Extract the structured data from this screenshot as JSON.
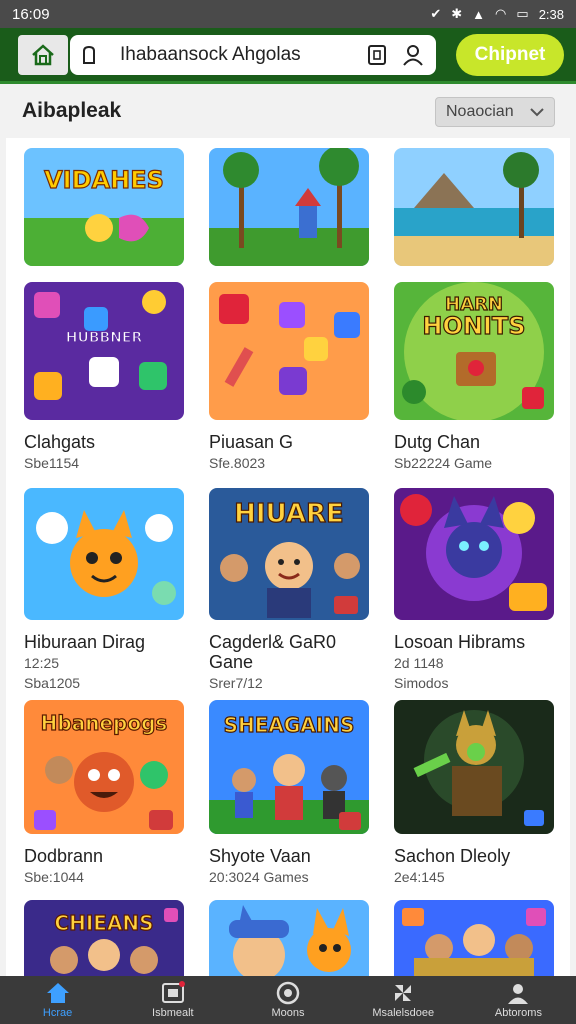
{
  "status": {
    "time": "16:09",
    "clock": "2:38"
  },
  "topbar": {
    "search_text": "Ihabaansock Ahgolas",
    "cta_label": "Chipnet"
  },
  "header": {
    "title": "Aibapleak",
    "sort_label": "Noaocian"
  },
  "games": [
    {
      "name": "",
      "meta": "",
      "meta2": "",
      "art": "title-art"
    },
    {
      "name": "",
      "meta": "",
      "meta2": "",
      "art": "palm-tower"
    },
    {
      "name": "",
      "meta": "",
      "meta2": "",
      "art": "beach"
    },
    {
      "name": "Clahgats",
      "meta": "Sbe1154",
      "meta2": "",
      "art": "dice-purple"
    },
    {
      "name": "Piuasan G",
      "meta": "Sfe.8023",
      "meta2": "",
      "art": "dice-orange"
    },
    {
      "name": "Dutg Chan",
      "meta": "Sb22224 Game",
      "meta2": "",
      "art": "harn-honits"
    },
    {
      "name": "Hiburaan Dirag",
      "meta": "12:25",
      "meta2": "Sba1205",
      "art": "cat"
    },
    {
      "name": "Cagderl& GaR0 Gane",
      "meta": "Srer7/12",
      "meta2": "",
      "art": "hiuare"
    },
    {
      "name": "Losoan Hibrams",
      "meta": "2d 1148",
      "meta2": "Simodos",
      "art": "wolf"
    },
    {
      "name": "Dodbrann",
      "meta": "Sbe:1044",
      "meta2": "",
      "art": "hbanepogs"
    },
    {
      "name": "Shyote Vaan",
      "meta": "20:3024 Games",
      "meta2": "",
      "art": "sheagains"
    },
    {
      "name": "Sachon Dleoly",
      "meta": "2e4:145",
      "meta2": "",
      "art": "warrior"
    },
    {
      "name": "",
      "meta": "",
      "meta2": "",
      "art": "chieans"
    },
    {
      "name": "",
      "meta": "",
      "meta2": "",
      "art": "fox-kid"
    },
    {
      "name": "",
      "meta": "",
      "meta2": "",
      "art": "crew"
    }
  ],
  "art_text": {
    "title-art": "VIDAHES",
    "harn-honits": "HARN HONITS",
    "hiuare": "HIUARE",
    "hbanepogs": "Hbanepogs",
    "sheagains": "SHEAGAINS",
    "chieans": "CHIEANS",
    "hiburaan": "HUBBNER"
  },
  "nav": [
    {
      "label": "Hcrae",
      "icon": "home-icon"
    },
    {
      "label": "Isbmealt",
      "icon": "store-icon"
    },
    {
      "label": "Moons",
      "icon": "circle-icon"
    },
    {
      "label": "Msalelsdoee",
      "icon": "pinwheel-icon"
    },
    {
      "label": "Abtoroms",
      "icon": "person-icon"
    }
  ],
  "colors": {
    "topbar": "#1a5c1a",
    "cta": "#c8e62a",
    "active_nav": "#3ea0ff"
  }
}
